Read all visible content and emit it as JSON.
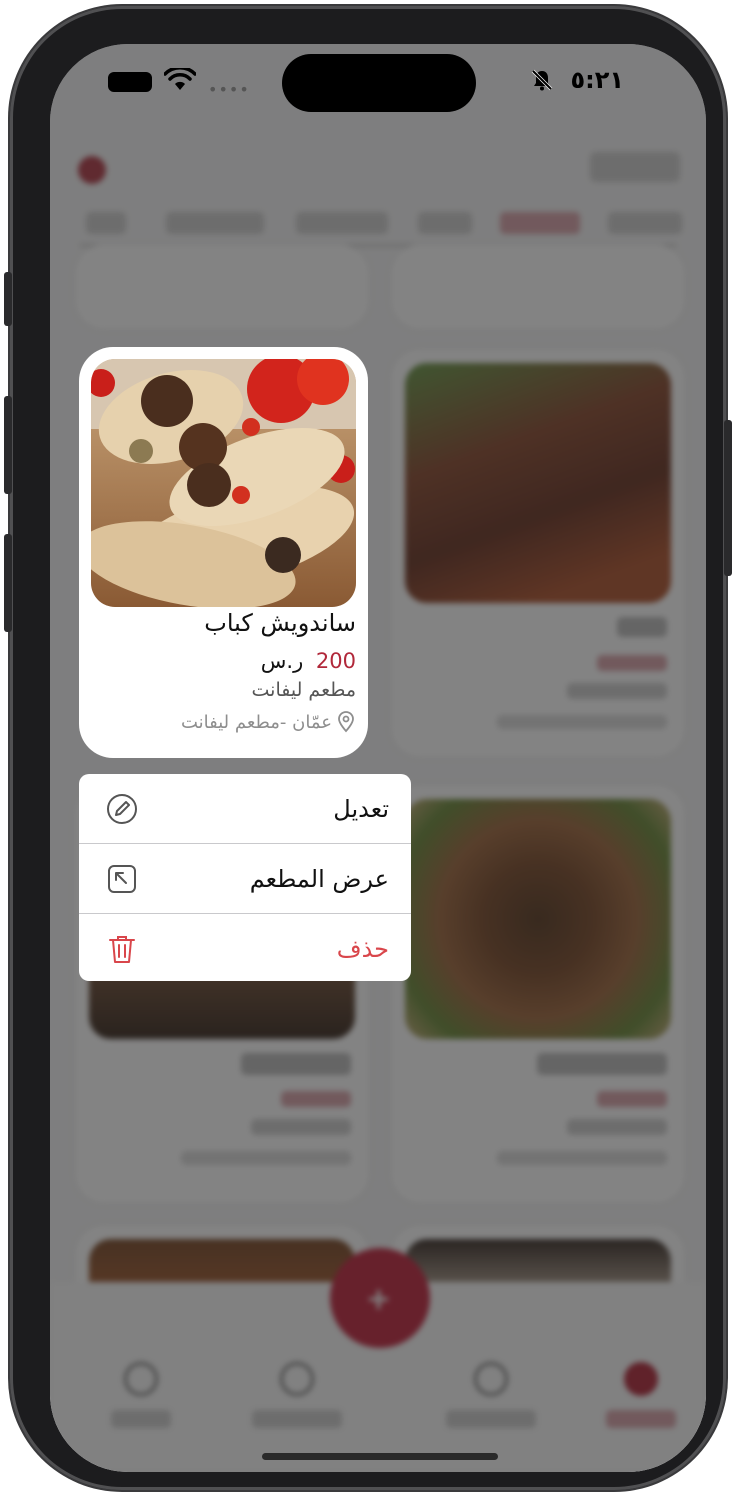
{
  "status_bar": {
    "time": "٥:٢١",
    "icons": [
      "battery-icon",
      "wifi-icon",
      "bell-slash-icon"
    ]
  },
  "focused_item": {
    "name": "ساندويش كباب",
    "price": "200",
    "currency": "ر.س",
    "restaurant": "مطعم ليفانت",
    "location": "عمّان -مطعم ليفانت"
  },
  "context_menu": {
    "items": [
      {
        "label": "تعديل",
        "icon": "edit-icon"
      },
      {
        "label": "عرض المطعم",
        "icon": "open-external-icon"
      },
      {
        "label": "حذف",
        "icon": "trash-icon",
        "color": "#d9464b"
      }
    ]
  },
  "colors": {
    "accent": "#b1283a",
    "danger": "#d9464b",
    "overlay": "rgba(30,30,30,0.55)"
  }
}
